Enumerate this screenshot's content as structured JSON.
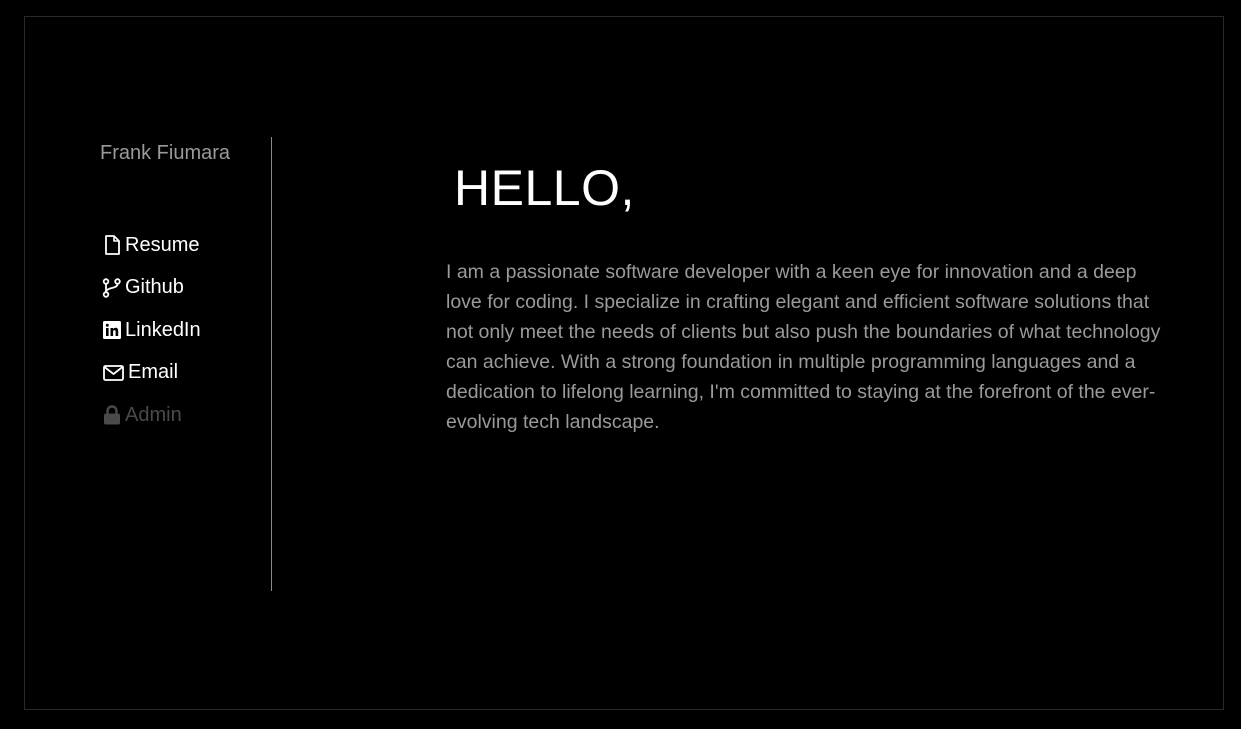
{
  "sidebar": {
    "owner_name": "Frank Fiumara",
    "items": [
      {
        "label": "Resume",
        "icon": "file-icon",
        "enabled": true
      },
      {
        "label": "Github",
        "icon": "code-branch-icon",
        "enabled": true
      },
      {
        "label": "LinkedIn",
        "icon": "linkedin-icon",
        "enabled": true
      },
      {
        "label": "Email",
        "icon": "envelope-icon",
        "enabled": true
      },
      {
        "label": "Admin",
        "icon": "lock-icon",
        "enabled": false
      }
    ]
  },
  "main": {
    "greeting": "HELLO,",
    "bio": "I am a passionate software developer with a keen eye for innovation and a deep love for coding. I specialize in crafting elegant and efficient software solutions that not only meet the needs of clients but also push the boundaries of what technology can achieve. With a strong foundation in multiple programming languages and a dedication to lifelong learning, I'm committed to staying at the forefront of the ever-evolving tech landscape."
  },
  "colors": {
    "background": "#000000",
    "link": "#ffffff",
    "muted_text": "#9a9a9a",
    "disabled": "#4a4a4a",
    "divider": "#8a8a8a"
  }
}
